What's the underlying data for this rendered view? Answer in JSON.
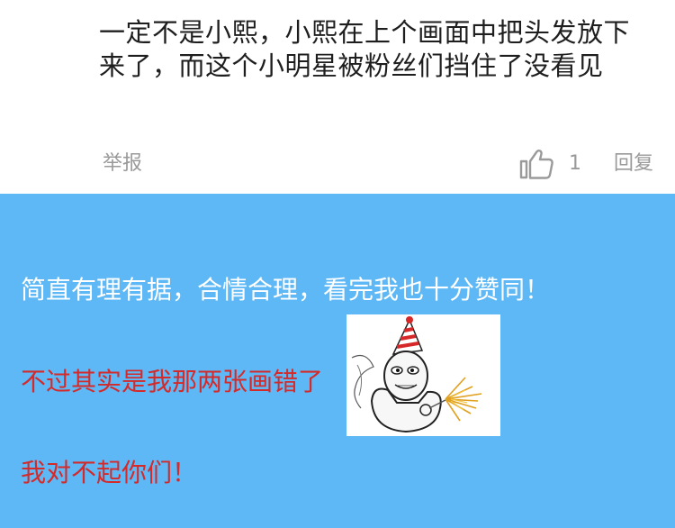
{
  "comment": {
    "text": "一定不是小熙，小熙在上个画面中把头发放下来了，而这个小明星被粉丝们挡住了没看见",
    "report_label": "举报",
    "like_count": "1",
    "reply_label": "回复"
  },
  "post": {
    "line1": "简直有理有据，合情合理，看完我也十分赞同！",
    "line2": "不过其实是我那两张画错了",
    "line3": "我对不起你们！"
  },
  "colors": {
    "panel_blue": "#5db8f5",
    "apology_red": "#d42a2a",
    "meta_gray": "#9a9a9a"
  },
  "icons": {
    "like": "thumbs-up-icon"
  }
}
